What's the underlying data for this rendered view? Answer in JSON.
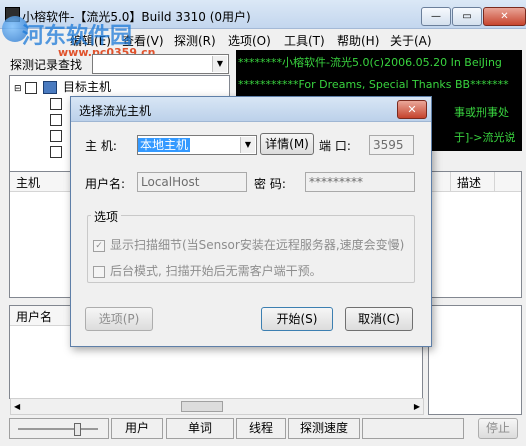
{
  "window": {
    "title": "小榕软件-【流光5.0】Build 3310 (0用户)",
    "controls": {
      "minimize": "—",
      "maximize": "▭",
      "close": "✕"
    }
  },
  "watermark": {
    "line1": "河东软件园",
    "line2": "www.pc0359.cn"
  },
  "menu": [
    "编辑(E)",
    "查看(V)",
    "探测(R)",
    "选项(O)",
    "工具(T)",
    "帮助(H)",
    "关于(A)"
  ],
  "search": {
    "label": "探测记录查找",
    "value": ""
  },
  "tree": {
    "root": "目标主机"
  },
  "log": [
    "********小榕软件-流光5.0(c)2006.05.20 In BeiJing",
    "***********For Dreams, Special Thanks BB*******",
    "事或刑事处",
    "于]->流光说"
  ],
  "host_list": {
    "columns": [
      "主机",
      "描述"
    ]
  },
  "user_list": {
    "columns": [
      "用户名"
    ]
  },
  "status": {
    "cells": [
      "用户",
      "单词",
      "线程",
      "探测速度"
    ],
    "stop": "停止"
  },
  "dialog": {
    "title": "选择流光主机",
    "host_label": "主 机:",
    "host_value": "本地主机",
    "details_button": "详情(M)",
    "port_label": "端 口:",
    "port_value": "3595",
    "username_label": "用户名:",
    "username_value": "LocalHost",
    "password_label": "密 码:",
    "password_value": "*********",
    "group_label": "选项",
    "options": [
      {
        "label": "显示扫描细节(当Sensor安装在远程服务器,速度会变慢)",
        "checked": true
      },
      {
        "label": "后台模式, 扫描开始后无需客户端干预。",
        "checked": false
      }
    ],
    "options_button": "选项(P)",
    "start_button": "开始(S)",
    "cancel_button": "取消(C)"
  }
}
